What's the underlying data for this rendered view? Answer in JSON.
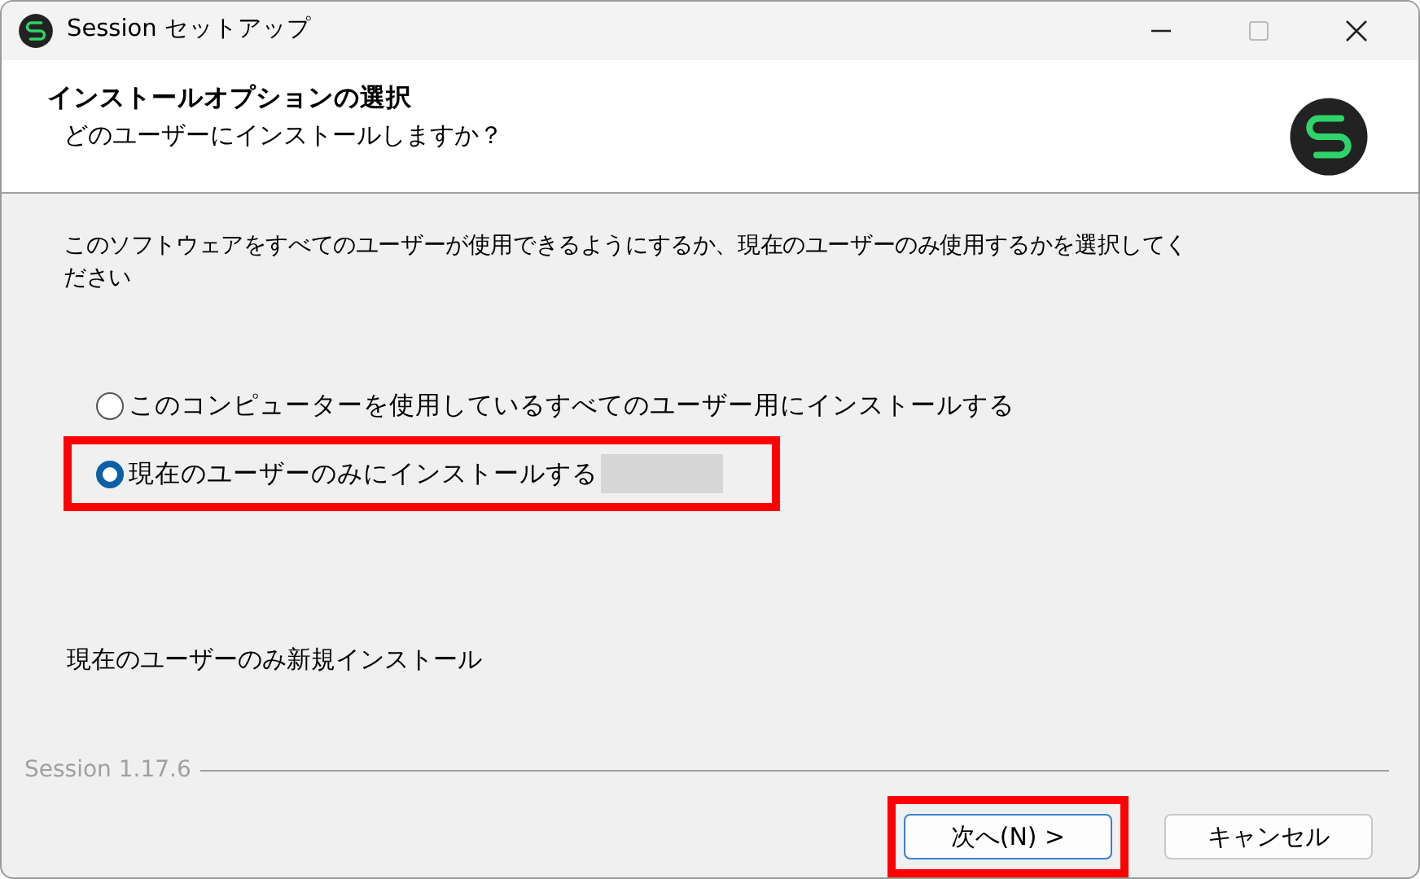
{
  "window": {
    "title": "Session セットアップ"
  },
  "header": {
    "title": "インストールオプションの選択",
    "subtitle": "どのユーザーにインストールしますか？"
  },
  "description": "このソフトウェアをすべてのユーザーが使用できるようにするか、現在のユーザーのみ使用するかを選択してください",
  "options": [
    {
      "label": "このコンピューターを使用しているすべてのユーザー用にインストールする",
      "selected": false,
      "highlighted": false
    },
    {
      "label": "現在のユーザーのみにインストールする",
      "selected": true,
      "highlighted": true
    }
  ],
  "status": "現在のユーザーのみ新規インストール",
  "version": "Session 1.17.6",
  "buttons": [
    {
      "label": "次へ(N) >",
      "default": true,
      "highlighted": true
    },
    {
      "label": "キャンセル",
      "default": false,
      "highlighted": false
    }
  ]
}
